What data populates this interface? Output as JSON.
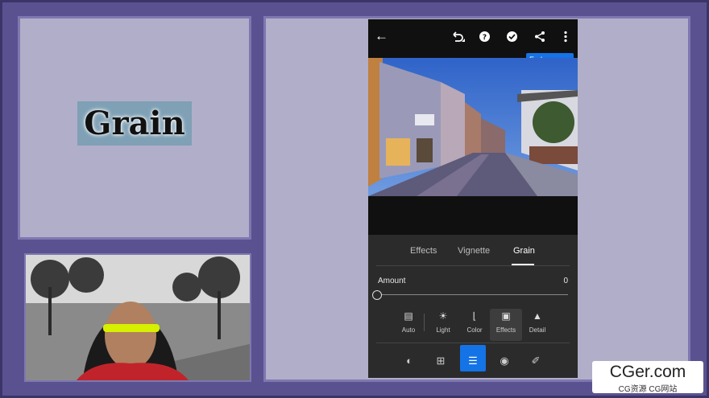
{
  "title_card": {
    "text": "Grain"
  },
  "topbar": {
    "back_icon": "arrow-left-icon",
    "undo_icon": "undo-icon",
    "help_icon": "help-circle-icon",
    "done_icon": "check-circle-icon",
    "share_icon": "share-icon",
    "more_icon": "more-vertical-icon",
    "tooltip": "Early access"
  },
  "tabs": [
    {
      "label": "Effects"
    },
    {
      "label": "Vignette"
    },
    {
      "label": "Grain",
      "active": true
    }
  ],
  "amount": {
    "label": "Amount",
    "value": "0"
  },
  "tools": [
    {
      "label": "Auto",
      "icon": "auto-icon"
    },
    {
      "label": "Light",
      "icon": "sun-icon"
    },
    {
      "label": "Color",
      "icon": "thermometer-icon"
    },
    {
      "label": "Effects",
      "icon": "effects-icon",
      "active": true
    },
    {
      "label": "Detail",
      "icon": "triangle-icon"
    }
  ],
  "bottom_icons": [
    "presets-icon",
    "crop-icon",
    "edit-sliders-icon",
    "mask-icon",
    "heal-icon"
  ],
  "watermark": {
    "line1": "CGer.com",
    "line2": "CG资源 CG网站"
  },
  "colors": {
    "accent": "#1473e6",
    "panel": "#2b2b2b",
    "frame": "#5a5290"
  }
}
